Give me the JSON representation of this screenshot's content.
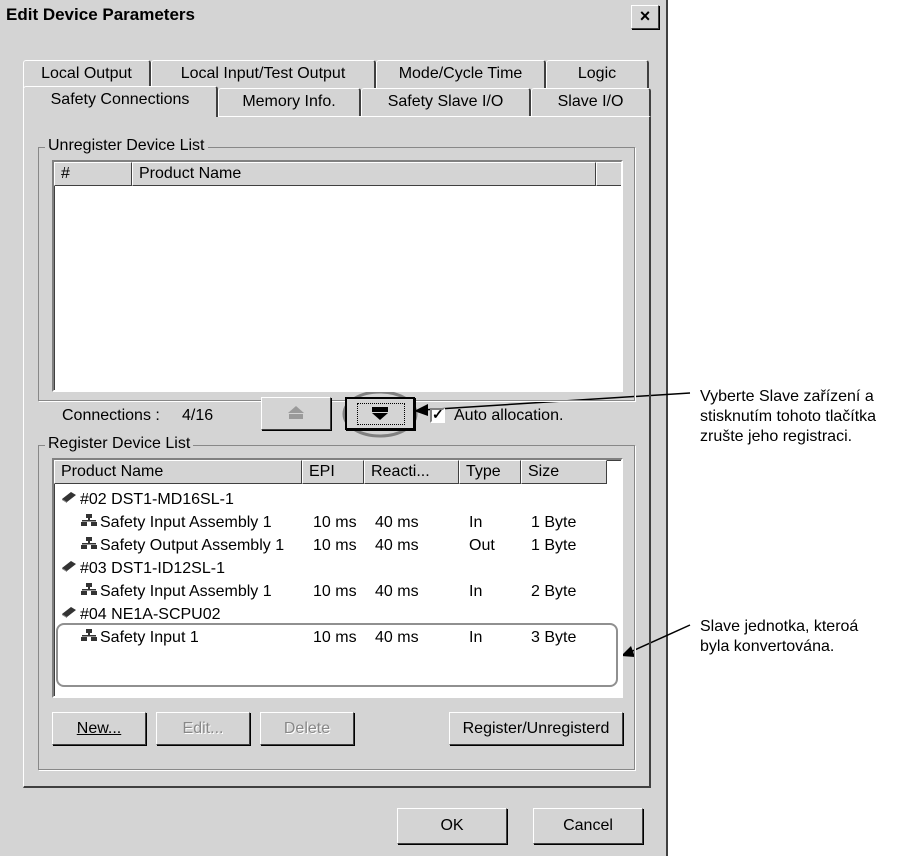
{
  "dialog": {
    "title": "Edit Device Parameters",
    "close_label": "×"
  },
  "tabs": {
    "row1": [
      "Local Output",
      "Local Input/Test Output",
      "Mode/Cycle Time",
      "Logic"
    ],
    "row2": [
      "Safety Connections",
      "Memory Info.",
      "Safety Slave I/O",
      "Slave I/O"
    ]
  },
  "unregister": {
    "group_label": "Unregister Device List",
    "col_num": "#",
    "col_product": "Product Name"
  },
  "connections": {
    "label": "Connections :",
    "value": "4/16",
    "auto_label": "Auto allocation.",
    "auto_checked": true
  },
  "register": {
    "group_label": "Register Device List",
    "headers": [
      "Product Name",
      "EPI",
      "Reacti...",
      "Type",
      "Size"
    ],
    "rows": [
      {
        "kind": "device",
        "name": "#02 DST1-MD16SL-1",
        "epi": "",
        "react": "",
        "type": "",
        "size": ""
      },
      {
        "kind": "assembly",
        "name": "Safety Input Assembly 1",
        "epi": "10 ms",
        "react": "40 ms",
        "type": "In",
        "size": "1 Byte"
      },
      {
        "kind": "assembly",
        "name": "Safety Output Assembly 1",
        "epi": "10 ms",
        "react": "40 ms",
        "type": "Out",
        "size": "1 Byte"
      },
      {
        "kind": "device",
        "name": "#03 DST1-ID12SL-1",
        "epi": "",
        "react": "",
        "type": "",
        "size": ""
      },
      {
        "kind": "assembly",
        "name": "Safety Input Assembly 1",
        "epi": "10 ms",
        "react": "40 ms",
        "type": "In",
        "size": "2 Byte"
      },
      {
        "kind": "device",
        "name": "#04 NE1A-SCPU02",
        "epi": "",
        "react": "",
        "type": "",
        "size": ""
      },
      {
        "kind": "assembly",
        "name": "Safety Input 1",
        "epi": "10 ms",
        "react": "40 ms",
        "type": "In",
        "size": "3 Byte"
      }
    ]
  },
  "buttons": {
    "new": "New...",
    "edit": "Edit...",
    "delete": "Delete",
    "register_unregister": "Register/Unregisterd",
    "ok": "OK",
    "cancel": "Cancel"
  },
  "annotations": {
    "callout1": [
      "Vyberte Slave zařízení a",
      "stisknutím tohoto tlačítka",
      "zrušte jeho registraci."
    ],
    "callout2": [
      "Slave jednotka, kteroá",
      "byla konvertována."
    ]
  },
  "colors": {
    "dialog_bg": "#d4d4d4",
    "list_bg": "#ffffff",
    "highlight_outline": "#909090"
  }
}
